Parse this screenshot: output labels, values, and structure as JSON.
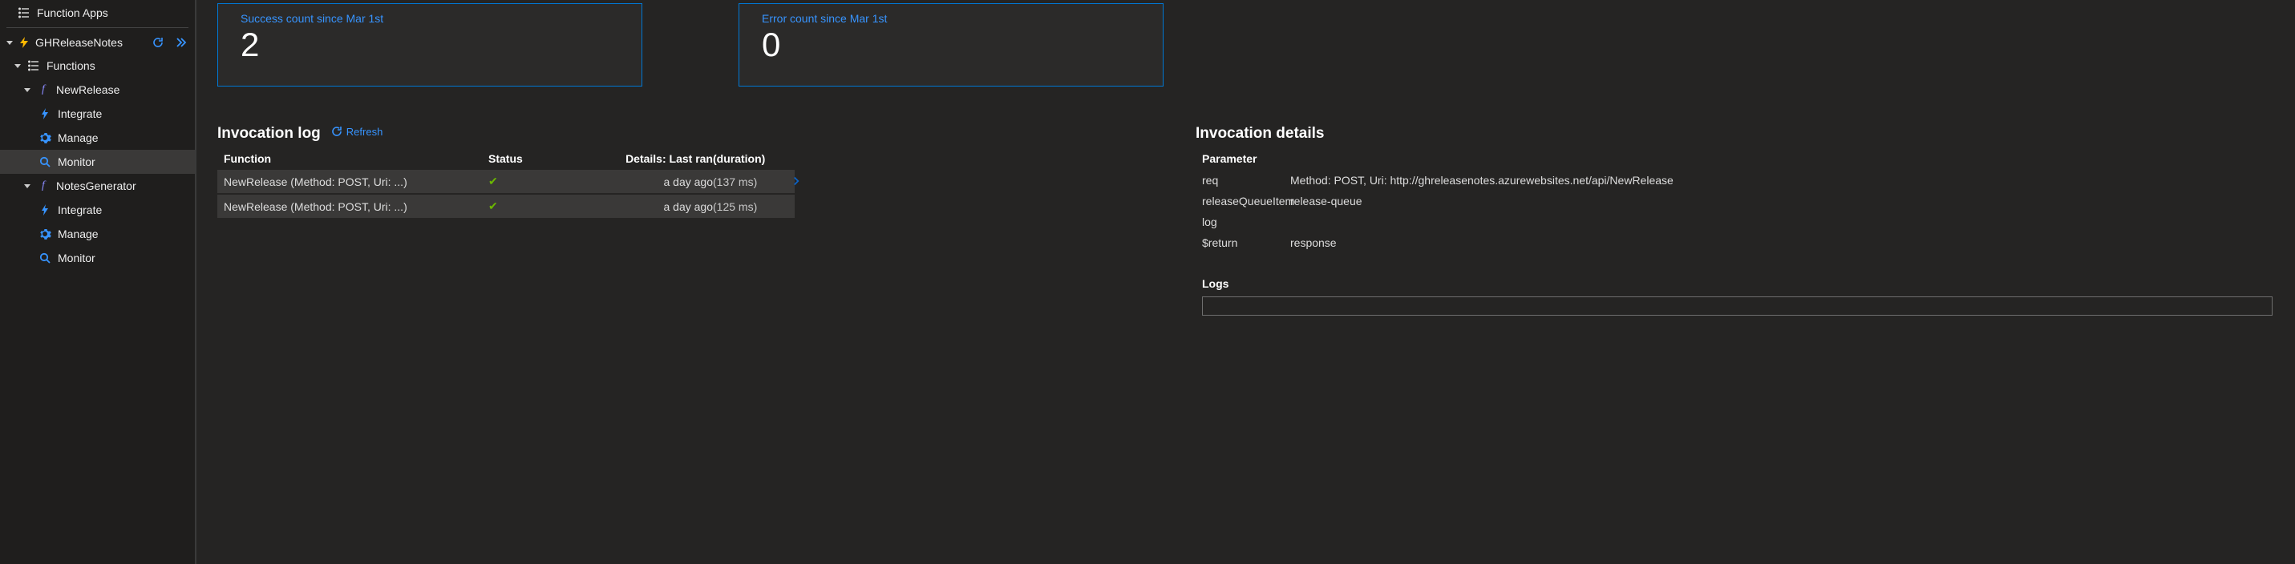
{
  "sidebar": {
    "header": "Function Apps",
    "app": {
      "name": "GHReleaseNotes"
    },
    "functions_label": "Functions",
    "functions": [
      {
        "name": "NewRelease",
        "items": [
          {
            "label": "Integrate",
            "icon": "bolt",
            "selected": false
          },
          {
            "label": "Manage",
            "icon": "gear",
            "selected": false
          },
          {
            "label": "Monitor",
            "icon": "search",
            "selected": true
          }
        ]
      },
      {
        "name": "NotesGenerator",
        "items": [
          {
            "label": "Integrate",
            "icon": "bolt",
            "selected": false
          },
          {
            "label": "Manage",
            "icon": "gear",
            "selected": false
          },
          {
            "label": "Monitor",
            "icon": "search",
            "selected": false
          }
        ]
      }
    ]
  },
  "stats": {
    "success": {
      "label": "Success count since Mar 1st",
      "value": "2"
    },
    "error": {
      "label": "Error count since Mar 1st",
      "value": "0"
    }
  },
  "invocation_log": {
    "title": "Invocation log",
    "refresh": "Refresh",
    "columns": {
      "fn": "Function",
      "status": "Status",
      "details": "Details: Last ran",
      "duration": "(duration)"
    },
    "rows": [
      {
        "fn": "NewRelease (Method: POST, Uri: ...)",
        "status": "ok",
        "last_ran": "a day ago",
        "duration": "(137 ms)",
        "active": true
      },
      {
        "fn": "NewRelease (Method: POST, Uri: ...)",
        "status": "ok",
        "last_ran": "a day ago",
        "duration": "(125 ms)",
        "active": false
      }
    ]
  },
  "invocation_details": {
    "title": "Invocation details",
    "param_header": "Parameter",
    "params": [
      {
        "name": "req",
        "value": "Method: POST, Uri: http://ghreleasenotes.azurewebsites.net/api/NewRelease"
      },
      {
        "name": "releaseQueueItem",
        "value": "release-queue"
      },
      {
        "name": "log",
        "value": ""
      },
      {
        "name": "$return",
        "value": "response"
      }
    ],
    "logs_header": "Logs"
  }
}
